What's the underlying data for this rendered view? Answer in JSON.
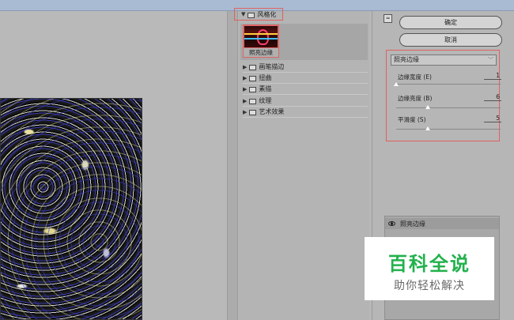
{
  "header": {
    "category": "风格化"
  },
  "thumbnail": {
    "label": "照亮边缘"
  },
  "categories": [
    "画笔描边",
    "扭曲",
    "素描",
    "纹理",
    "艺术效果"
  ],
  "buttons": {
    "collapse": "≈",
    "ok": "确定",
    "cancel": "取消"
  },
  "filter": {
    "selected": "照亮边缘"
  },
  "params": [
    {
      "label": "边缘宽度 (E)",
      "value": "1",
      "fraction": 0.0
    },
    {
      "label": "边缘亮度 (B)",
      "value": "6",
      "fraction": 0.3
    },
    {
      "label": "平滑度 (S)",
      "value": "5",
      "fraction": 0.3
    }
  ],
  "layer": {
    "name": "照亮边缘"
  },
  "watermark": {
    "title": "百科全说",
    "subtitle": "助你轻松解决"
  }
}
